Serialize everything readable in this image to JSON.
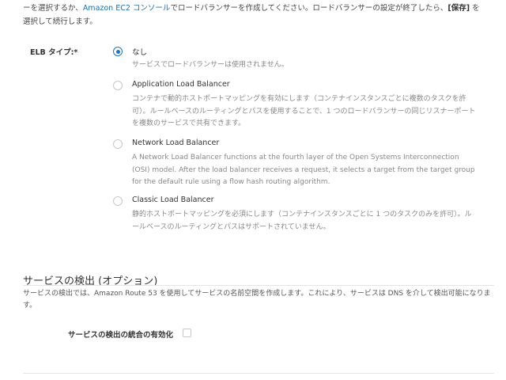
{
  "intro": {
    "line1_before_link": "ーを選択するか、",
    "link_text": "Amazon EC2 コンソール",
    "line1_after_link": "でロードバランサーを作成してください。ロードバランサーの設定が終了したら、",
    "save_label": "[保存]",
    "line1_end": " を",
    "line2": "選択して続行します。"
  },
  "elb": {
    "label": "ELB タイプ:*",
    "options": [
      {
        "title": "なし",
        "description": "サービスでロードバランサーは使用されません。",
        "selected": true
      },
      {
        "title": "Application Load Balancer",
        "description": "コンテナで動的ホストポートマッピングを有効にします（コンテナインスタンスごとに複数のタスクを許可）。ルールベースのルーティングとパスを使用することで、1 つのロードバランサーの同じリスナーポートを複数のサービスで共有できます。",
        "selected": false
      },
      {
        "title": "Network Load Balancer",
        "description": "A Network Load Balancer functions at the fourth layer of the Open Systems Interconnection (OSI) model. After the load balancer receives a request, it selects a target from the target group for the default rule using a flow hash routing algorithm.",
        "selected": false
      },
      {
        "title": "Classic Load Balancer",
        "description": "静的ホストポートマッピングを必須にします（コンテナインスタンスごとに 1 つのタスクのみを許可）。ルールベースのルーティングとパスはサポートされていません。",
        "selected": false
      }
    ]
  },
  "service_discovery": {
    "title": "サービスの検出 (オプション)",
    "description": "サービスの検出では、Amazon Route 53 を使用してサービスの名前空間を作成します。これにより、サービスは DNS を介して検出可能になります。",
    "enable_label": "サービスの検出の統合の有効化",
    "enabled": false
  },
  "colors": {
    "link": "#1a6fb5",
    "radio_selected": "#1a73d8",
    "muted_text": "#888888"
  }
}
